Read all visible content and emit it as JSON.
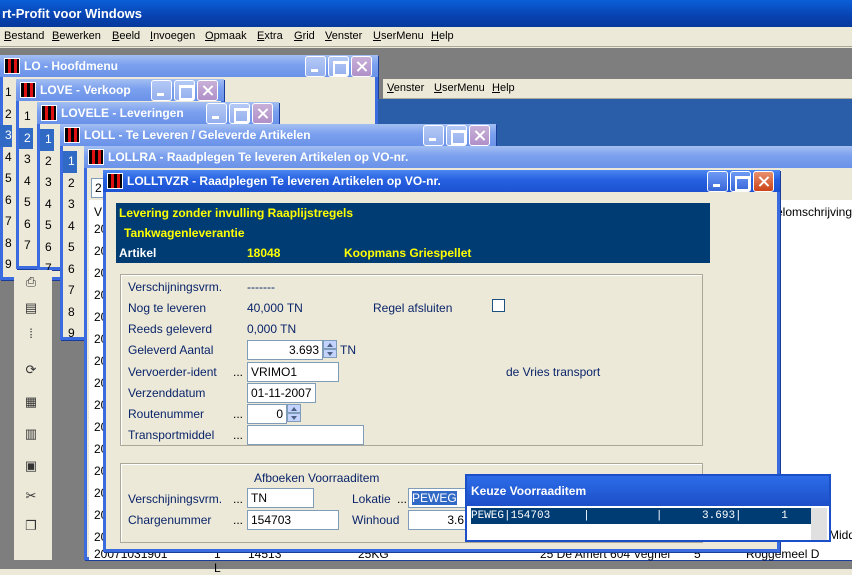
{
  "app": {
    "title": "rt-Profit voor Windows",
    "menu": [
      "Bestand",
      "Bewerken",
      "Beeld",
      "Invoegen",
      "Opmaak",
      "Extra",
      "Grid",
      "Venster",
      "UserMenu",
      "Help"
    ],
    "inner_menu": [
      "Venster",
      "UserMenu",
      "Help"
    ]
  },
  "windows": {
    "hoofdmenu": {
      "title": "LO - Hoofdmenu",
      "nums": [
        "1",
        "2",
        "3",
        "4",
        "5",
        "6",
        "7",
        "8",
        "9"
      ]
    },
    "verkoop": {
      "title": "LOVE - Verkoop",
      "nums": [
        "1",
        "2",
        "3",
        "4",
        "5",
        "6",
        "7",
        "8",
        "9"
      ]
    },
    "leveringen": {
      "title": "LOVELE - Leveringen",
      "nums": [
        "1",
        "2",
        "3",
        "4",
        "5",
        "6",
        "7"
      ]
    },
    "te_leveren": {
      "title": "LOLL - Te Leveren / Geleverde Artikelen",
      "nums": [
        "1",
        "2",
        "3",
        "4",
        "5",
        "6",
        "7",
        "8",
        "9"
      ]
    },
    "raadplegen": {
      "title": "LOLLRA - Raadplegen Te leveren Artikelen op VO-nr."
    },
    "dialog": {
      "title": "LOLLTVZR - Raadplegen Te leveren Artikelen op VO-nr."
    }
  },
  "grid": {
    "header_right": "elomschrijving",
    "row_prefix": "20",
    "right_texts": [
      "Middel",
      "Roggemeel D"
    ],
    "bottom_row": [
      "20071031901",
      "1 L",
      "14513",
      "25KG",
      "25 De Amert 604 Veghel",
      "5",
      "Roggemeel D"
    ]
  },
  "info": {
    "line1": "Levering zonder invulling Raaplijstregels",
    "line2": "Tankwagenleverantie",
    "artikel_label": "Artikel",
    "artikel_code": "18048",
    "artikel_name": "Koopmans Griespellet"
  },
  "form": {
    "verschijningsvrm_label": "Verschijningsvrm.",
    "verschijningsvrm_value": "-------",
    "nog_te_leveren_label": "Nog te leveren",
    "nog_te_leveren_value": "40,000 TN",
    "regel_afsluiten_label": "Regel afsluiten",
    "reeds_geleverd_label": "Reeds geleverd",
    "reeds_geleverd_value": "0,000 TN",
    "geleverd_aantal_label": "Geleverd Aantal",
    "geleverd_aantal_value": "3.693",
    "geleverd_aantal_unit": "TN",
    "vervoerder_label": "Vervoerder-ident",
    "vervoerder_value": "VRIMO1",
    "vervoerder_name": "de Vries transport",
    "verzenddatum_label": "Verzenddatum",
    "verzenddatum_value": "01-11-2007",
    "routenummer_label": "Routenummer",
    "routenummer_value": "0",
    "transportmiddel_label": "Transportmiddel",
    "transportmiddel_value": ""
  },
  "voorraad": {
    "group_title": "Afboeken Voorraaditem",
    "verschijningsvrm_label": "Verschijningsvrm.",
    "verschijningsvrm_value": "TN",
    "lokatie_label": "Lokatie",
    "lokatie_value": "PEWEG",
    "chargenummer_label": "Chargenummer",
    "chargenummer_value": "154703",
    "winhoud_label": "Winhoud",
    "winhoud_value": "3.6"
  },
  "popup": {
    "title": "Keuze Voorraaditem",
    "row": "PEWEG|154703     |          |      3.693|      1"
  },
  "dots": "..."
}
